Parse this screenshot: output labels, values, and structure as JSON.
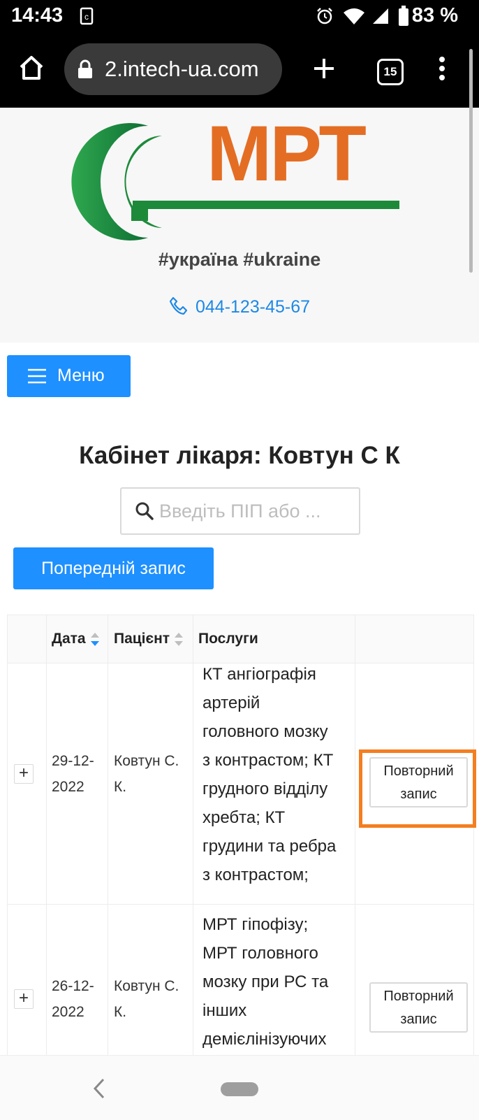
{
  "status_bar": {
    "time": "14:43",
    "battery": "83 %"
  },
  "browser": {
    "url": "2.intech-ua.com",
    "tab_count": "15"
  },
  "header": {
    "brand": "МРТ",
    "hashtags": "#україна #ukraine",
    "phone": "044-123-45-67",
    "colors": {
      "green": "#1d8a3a",
      "orange": "#e46d24"
    }
  },
  "menu": {
    "label": "Меню"
  },
  "page_title": "Кабінет лікаря: Ковтун С К",
  "search": {
    "placeholder": "Введіть ПІП або ..."
  },
  "prev_button": {
    "label": "Попередній запис"
  },
  "table": {
    "headers": {
      "date": "Дата",
      "patient": "Пацієнт",
      "services": "Послуги"
    },
    "rows": [
      {
        "date_line1": "29-12-",
        "date_line2": "2022",
        "patient_line1": "Ковтун С.",
        "patient_line2": "К.",
        "services": [
          "КТ ангіографія",
          "артерій",
          "головного мозку",
          "з контрастом; КТ",
          "грудного відділу",
          "хребта; КТ",
          "грудини та ребра",
          "з контрастом;"
        ],
        "button_line1": "Повторний",
        "button_line2": "запис"
      },
      {
        "date_line1": "26-12-",
        "date_line2": "2022",
        "patient_line1": "Ковтун С.",
        "patient_line2": "К.",
        "services": [
          "МРТ гіпофізу;",
          "МРТ головного",
          "мозку при РС та",
          "інших",
          "демієлінізуючих"
        ],
        "button_line1": "Повторний",
        "button_line2": "запис"
      }
    ]
  },
  "colors": {
    "primary": "#1e90ff",
    "highlight": "#f47e20"
  }
}
